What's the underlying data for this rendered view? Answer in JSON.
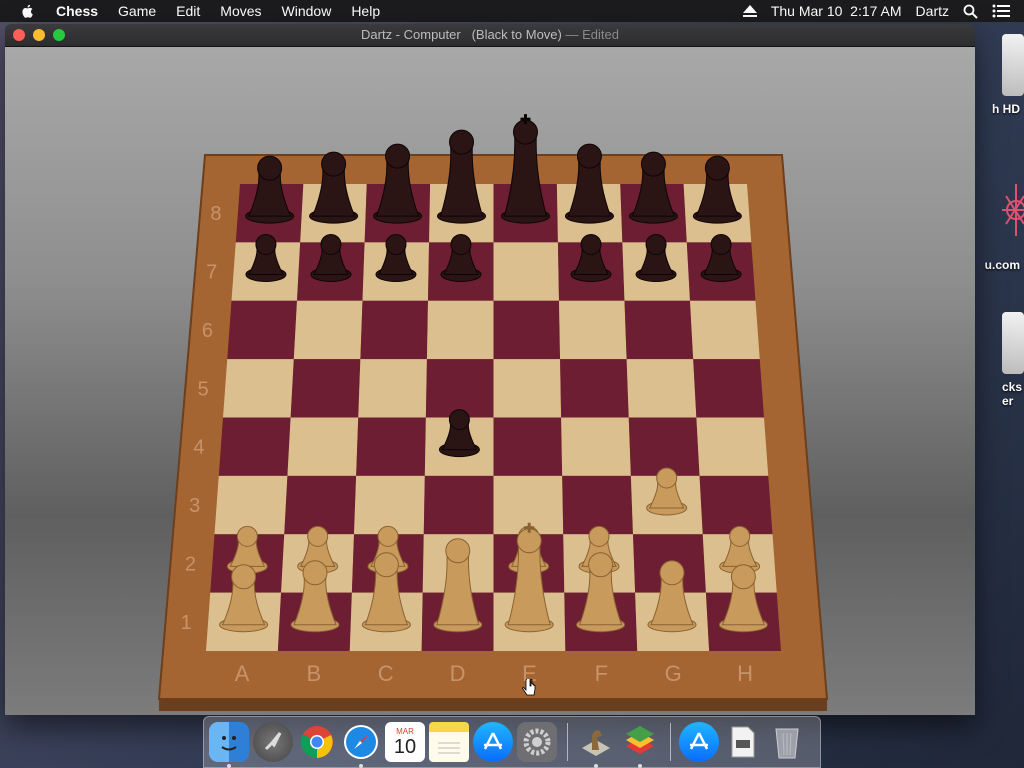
{
  "menubar": {
    "app": "Chess",
    "items": [
      "Game",
      "Edit",
      "Moves",
      "Window",
      "Help"
    ],
    "clock": "Thu Mar 10  2:17 AM",
    "user": "Dartz",
    "icons": [
      "apple-logo-icon",
      "eject-icon",
      "spotlight-search-icon",
      "notification-center-icon"
    ]
  },
  "desktop": {
    "icons": [
      {
        "label": "h HD",
        "icon": "hard-drive-icon"
      },
      {
        "label": "u.com",
        "icon": "network-icon"
      },
      {
        "label": "cks\ner",
        "icon": "drive-icon"
      }
    ]
  },
  "window": {
    "title": "Dartz - Computer",
    "subtitle": "(Black to Move)",
    "edited": "— Edited"
  },
  "board": {
    "files": [
      "A",
      "B",
      "C",
      "D",
      "E",
      "F",
      "G",
      "H"
    ],
    "ranks": [
      "1",
      "2",
      "3",
      "4",
      "5",
      "6",
      "7",
      "8"
    ],
    "colors": {
      "dark": "#6e1e32",
      "light": "#dcbf8e",
      "frame": "#a86a3a",
      "white_piece": "#c89a5c",
      "black_piece": "#2a1414"
    },
    "pieces": [
      {
        "sq": "a8",
        "c": "b",
        "t": "R"
      },
      {
        "sq": "b8",
        "c": "b",
        "t": "N"
      },
      {
        "sq": "c8",
        "c": "b",
        "t": "B"
      },
      {
        "sq": "d8",
        "c": "b",
        "t": "Q"
      },
      {
        "sq": "e8",
        "c": "b",
        "t": "K"
      },
      {
        "sq": "f8",
        "c": "b",
        "t": "B"
      },
      {
        "sq": "g8",
        "c": "b",
        "t": "N"
      },
      {
        "sq": "h8",
        "c": "b",
        "t": "R"
      },
      {
        "sq": "a7",
        "c": "b",
        "t": "P"
      },
      {
        "sq": "b7",
        "c": "b",
        "t": "P"
      },
      {
        "sq": "c7",
        "c": "b",
        "t": "P"
      },
      {
        "sq": "d7",
        "c": "b",
        "t": "P"
      },
      {
        "sq": "f7",
        "c": "b",
        "t": "P"
      },
      {
        "sq": "g7",
        "c": "b",
        "t": "P"
      },
      {
        "sq": "h7",
        "c": "b",
        "t": "P"
      },
      {
        "sq": "d4",
        "c": "b",
        "t": "P"
      },
      {
        "sq": "g3",
        "c": "w",
        "t": "P"
      },
      {
        "sq": "a2",
        "c": "w",
        "t": "P"
      },
      {
        "sq": "b2",
        "c": "w",
        "t": "P"
      },
      {
        "sq": "c2",
        "c": "w",
        "t": "P"
      },
      {
        "sq": "e2",
        "c": "w",
        "t": "P"
      },
      {
        "sq": "f2",
        "c": "w",
        "t": "P"
      },
      {
        "sq": "h2",
        "c": "w",
        "t": "P"
      },
      {
        "sq": "a1",
        "c": "w",
        "t": "R"
      },
      {
        "sq": "b1",
        "c": "w",
        "t": "N"
      },
      {
        "sq": "c1",
        "c": "w",
        "t": "B"
      },
      {
        "sq": "d1",
        "c": "w",
        "t": "Q"
      },
      {
        "sq": "e1",
        "c": "w",
        "t": "K"
      },
      {
        "sq": "f1",
        "c": "w",
        "t": "B"
      },
      {
        "sq": "g1",
        "c": "w",
        "t": "N"
      },
      {
        "sq": "h1",
        "c": "w",
        "t": "R"
      }
    ]
  },
  "dock": {
    "apps": [
      {
        "name": "finder",
        "icon": "finder-icon",
        "running": true
      },
      {
        "name": "launchpad",
        "icon": "rocket-icon",
        "running": false
      },
      {
        "name": "chrome",
        "icon": "chrome-icon",
        "running": false
      },
      {
        "name": "safari",
        "icon": "compass-icon",
        "running": true
      },
      {
        "name": "calendar",
        "icon": "calendar-icon",
        "running": false,
        "month": "MAR",
        "day": "10"
      },
      {
        "name": "notes",
        "icon": "notes-icon",
        "running": false
      },
      {
        "name": "app-store",
        "icon": "app-store-icon",
        "running": false
      },
      {
        "name": "system-preferences",
        "icon": "gear-icon",
        "running": false
      },
      {
        "name": "chess",
        "icon": "chess-knight-icon",
        "running": true
      },
      {
        "name": "bluestacks",
        "icon": "layers-icon",
        "running": true
      }
    ],
    "others": [
      {
        "name": "app-store-downloads",
        "icon": "app-store-icon"
      },
      {
        "name": "document",
        "icon": "document-icon"
      },
      {
        "name": "trash",
        "icon": "trash-icon"
      }
    ]
  }
}
